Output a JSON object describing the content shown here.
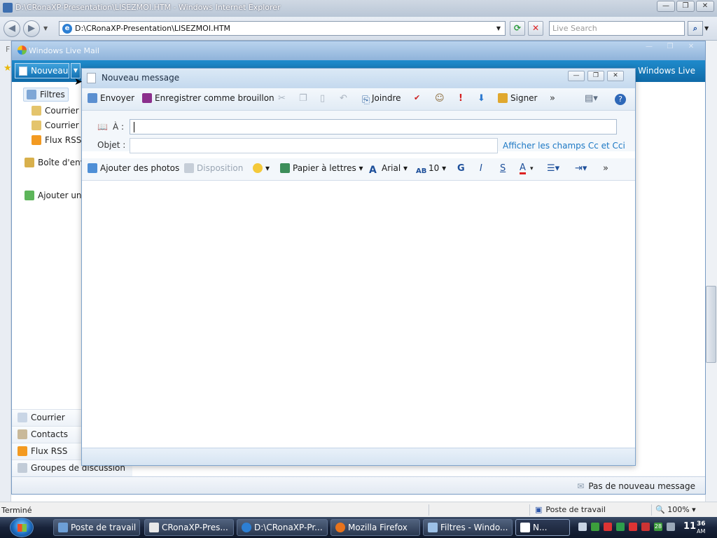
{
  "ie": {
    "title": "D:\\CRonaXP-Presentation\\LISEZMOI.HTM - Windows Internet Explorer",
    "address": "D:\\CRonaXP-Presentation\\LISEZMOI.HTM",
    "search_placeholder": "Live Search",
    "left_letter": "F",
    "status": "Terminé",
    "zone": "Poste de travail",
    "zoom": "100%"
  },
  "wlm": {
    "title": "Windows Live Mail",
    "new_label": "Nouveau",
    "signin": "n Windows Live",
    "sidebar": {
      "filtres": "Filtres",
      "courrier1": "Courrier i",
      "courrier2": "Courrier i",
      "flux": "Flux RSS",
      "boite": "Boîte d'envo",
      "ajouter": "Ajouter un c"
    },
    "bottom_nav": [
      "Courrier",
      "Contacts",
      "Flux RSS",
      "Groupes de discussion"
    ],
    "status": "Pas de nouveau message"
  },
  "message": {
    "title": "Nouveau message",
    "toolbar": {
      "send": "Envoyer",
      "save_draft": "Enregistrer comme brouillon",
      "attach": "Joindre",
      "sign": "Signer",
      "more": "»"
    },
    "to_label": "À :",
    "subject_label": "Objet :",
    "cc_link": "Afficher les champs Cc et Cci",
    "format": {
      "add_photos": "Ajouter des photos",
      "layout": "Disposition",
      "stationery": "Papier à lettres",
      "font": "Arial",
      "size": "10",
      "bold": "G",
      "italic": "I",
      "underline": "S",
      "color": "A",
      "more": "»"
    }
  },
  "taskbar": {
    "items": [
      "Poste de travail",
      "CRonaXP-Pres...",
      "D:\\CRonaXP-Pr...",
      "Mozilla Firefox",
      "Filtres - Windo...",
      "N..."
    ],
    "clock_hour": "11",
    "clock_min": "36",
    "clock_ampm": "AM",
    "tray_badge": "28"
  }
}
